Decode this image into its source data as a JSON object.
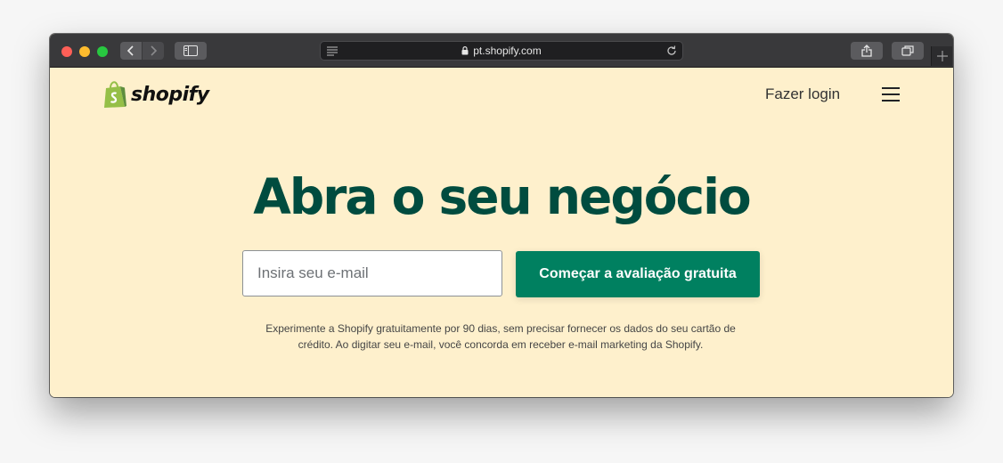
{
  "browser": {
    "url": "pt.shopify.com",
    "icons": [
      "back-icon",
      "forward-icon",
      "sidebar-icon",
      "reader-icon",
      "lock-icon",
      "reload-icon",
      "share-icon",
      "tabs-icon",
      "plus-icon"
    ]
  },
  "header": {
    "logo_text": "shopify",
    "login_label": "Fazer login"
  },
  "hero": {
    "title": "Abra o seu negócio",
    "email_placeholder": "Insira seu e-mail",
    "cta_label": "Começar a avaliação gratuita",
    "disclaimer_line1": "Experimente a Shopify gratuitamente por 90 dias, sem precisar fornecer os dados do seu cartão de",
    "disclaimer_line2": "crédito. Ao digitar seu e-mail, você concorda em receber e-mail marketing da Shopify."
  },
  "colors": {
    "page_bg": "#fef0cc",
    "title": "#004c3f",
    "cta": "#008060",
    "logo_bag": "#95bf47"
  }
}
